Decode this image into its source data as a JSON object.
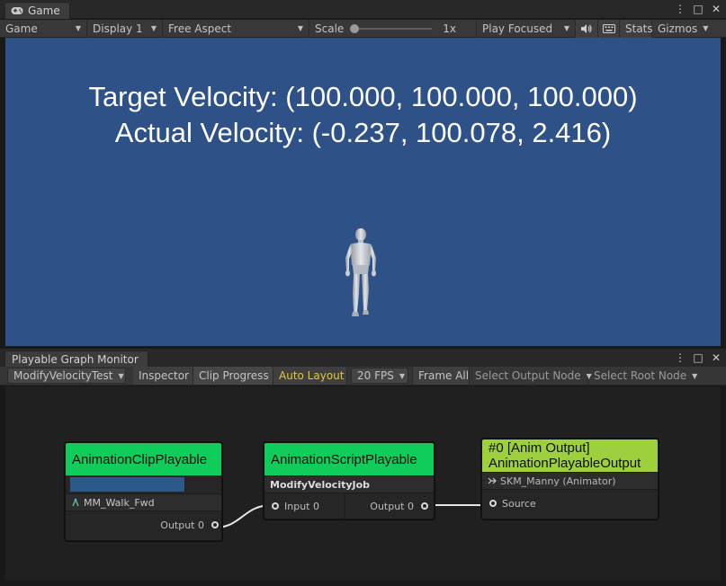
{
  "game_window": {
    "tab_label": "Game",
    "tab_icon": "gamepad-icon",
    "controls": {
      "more": "⋮",
      "maximize": "□",
      "close": "✕"
    },
    "toolbar": {
      "mode": "Game",
      "display": "Display 1",
      "aspect": "Free Aspect",
      "scale_label": "Scale",
      "scale_value": "1x",
      "play_mode": "Play Focused",
      "stats": "Stats",
      "gizmos": "Gizmos"
    },
    "view": {
      "background": "#2e5187",
      "target_velocity": "Target Velocity: (100.000, 100.000, 100.000)",
      "actual_velocity": "Actual Velocity: (-0.237, 100.078, 2.416)"
    }
  },
  "graph_window": {
    "tab_label": "Playable Graph Monitor",
    "controls": {
      "more": "⋮",
      "maximize": "□",
      "close": "✕"
    },
    "toolbar": {
      "graph": "ModifyVelocityTest",
      "inspector": "Inspector",
      "clip_progress": "Clip Progress",
      "auto_layout": "Auto Layout",
      "fps": "20 FPS",
      "frame_all": "Frame All",
      "select_output": "Select Output Node",
      "select_root": "Select Root Node"
    },
    "nodes": {
      "clip": {
        "title": "AnimationClipPlayable",
        "color": "#10cc5a",
        "progress": 0.78,
        "progress_color": "#2b5a8a",
        "clip_name": "MM_Walk_Fwd",
        "output_port": "Output 0"
      },
      "script": {
        "title": "AnimationScriptPlayable",
        "color": "#10cc5a",
        "job_name": "ModifyVelocityJob",
        "input_port": "Input 0",
        "output_port": "Output 0"
      },
      "output": {
        "title_line1": "#0 [Anim Output]",
        "title_line2": "AnimationPlayableOutput",
        "color": "#9ecf3c",
        "target": "SKM_Manny (Animator)",
        "source_port": "Source"
      }
    },
    "auto_layout_color": "#e5c43a"
  }
}
